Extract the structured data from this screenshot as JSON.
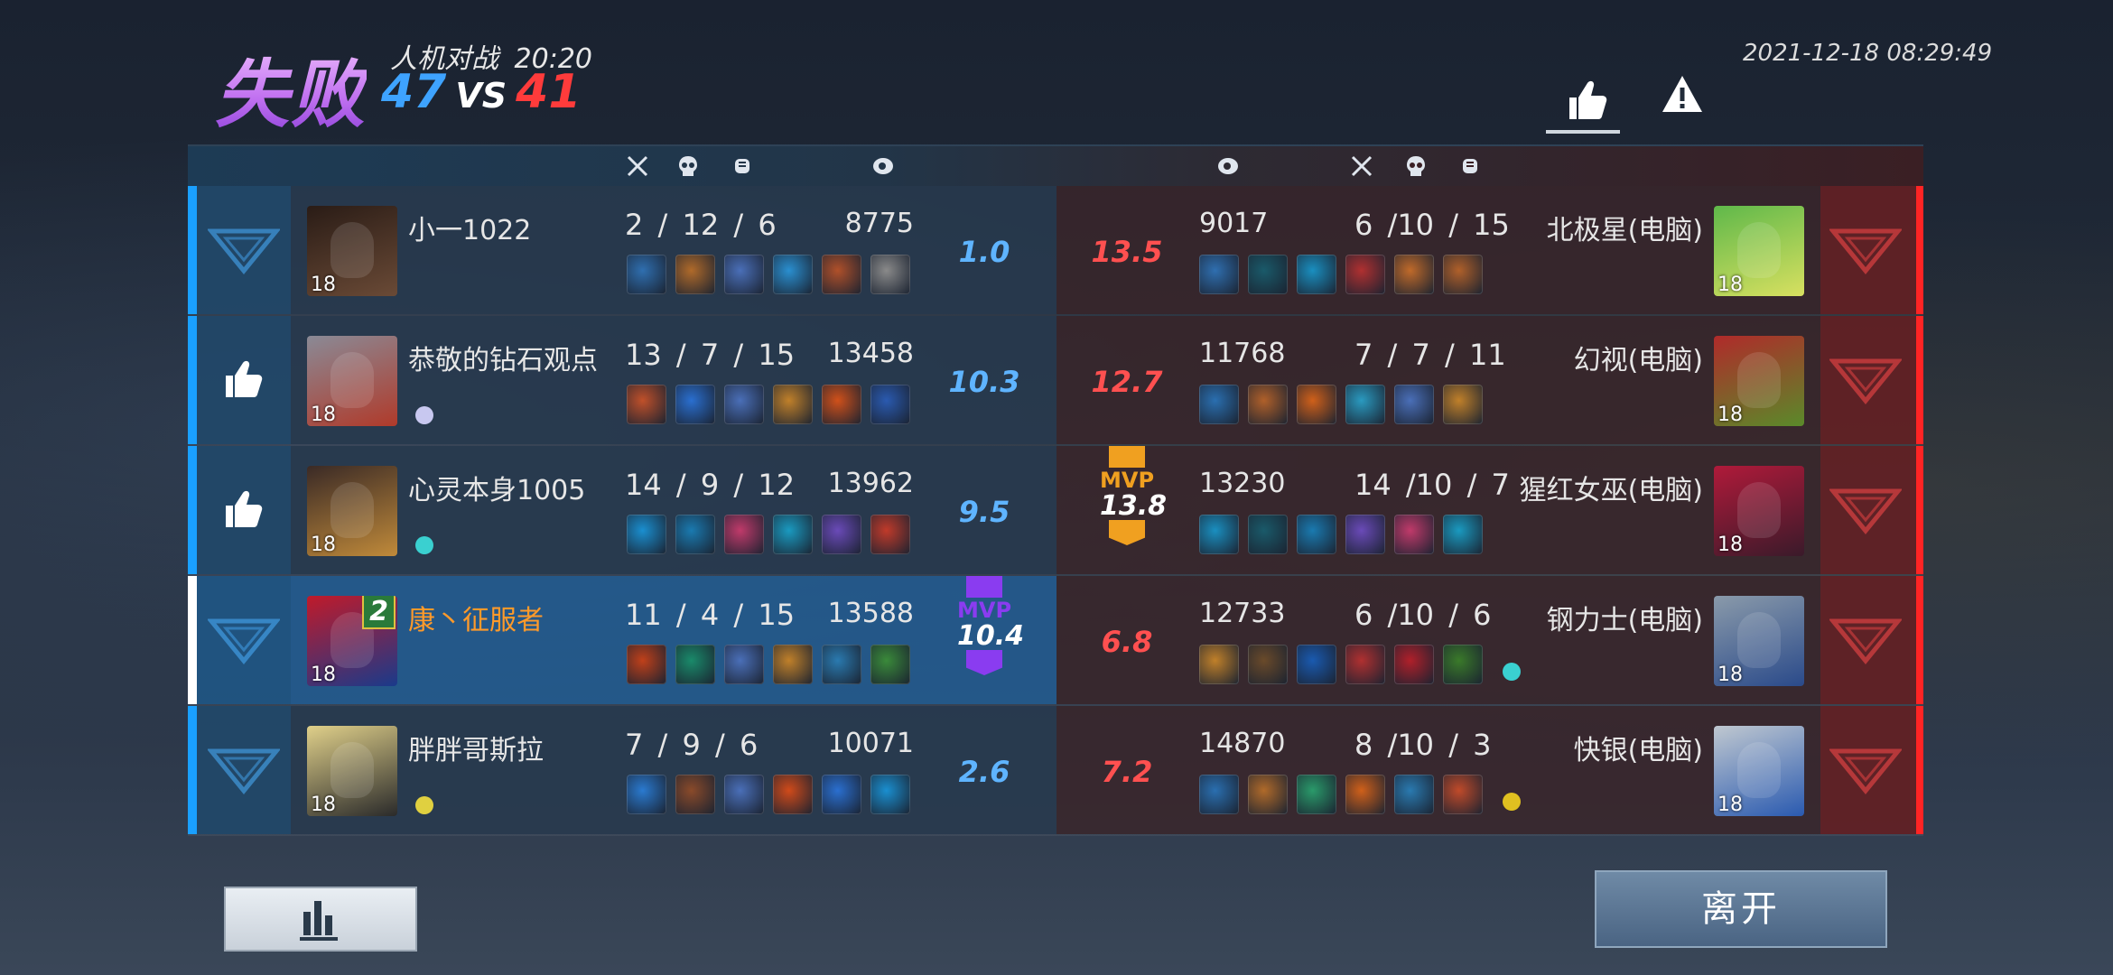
{
  "header": {
    "result": "失败",
    "mode": "人机对战",
    "duration": "20:20",
    "score_blue": "47",
    "score_vs": "VS",
    "score_red": "41",
    "datetime": "2021-12-18 08:29:49"
  },
  "columns": {
    "kills_icon": "crossed-swords-icon",
    "deaths_icon": "skull-icon",
    "assists_icon": "fist-icon",
    "damage_icon": "eye-icon"
  },
  "rows": [
    {
      "blue": {
        "name": "小一1022",
        "level": "18",
        "kda": "2 / 12 / 6",
        "damage": "8775",
        "score": "1.0",
        "action": "dislike",
        "self": false,
        "avatar_colors": [
          "#2a1c16",
          "#6a4a36"
        ],
        "items": [
          "#2f6fb0",
          "#b06a2a",
          "#4a6fb8",
          "#2a8fd0",
          "#b0502a",
          "#8a8a8a"
        ],
        "badge": ""
      },
      "red": {
        "name": "北极星(电脑)",
        "level": "18",
        "kda": "6 /10 / 15",
        "damage": "9017",
        "score": "13.5",
        "avatar_colors": [
          "#5fb84a",
          "#d8e060"
        ],
        "items": [
          "#2f6fb0",
          "#1a5a6a",
          "#1a8fc0",
          "#b03030",
          "#c06a2a",
          "#b0602a"
        ],
        "badge": ""
      }
    },
    {
      "blue": {
        "name": "恭敬的钻石观点",
        "level": "18",
        "kda": "13 / 7 / 15",
        "damage": "13458",
        "score": "10.3",
        "action": "like",
        "self": false,
        "avatar_colors": [
          "#8a8a96",
          "#b03a2a"
        ],
        "items": [
          "#c0502a",
          "#2a6fd0",
          "#4a6fb8",
          "#c0802a",
          "#d0501a",
          "#2a5ab0"
        ],
        "badge": "#c8c8f0"
      },
      "red": {
        "name": "幻视(电脑)",
        "level": "18",
        "kda": "7 / 7 / 11",
        "damage": "11768",
        "score": "12.7",
        "avatar_colors": [
          "#b02a2a",
          "#5a8a2a"
        ],
        "items": [
          "#2a6fb0",
          "#b0602a",
          "#d0601a",
          "#2a9ac0",
          "#4a6fb8",
          "#c0802a"
        ],
        "badge": ""
      }
    },
    {
      "blue": {
        "name": "心灵本身1005",
        "level": "18",
        "kda": "14 / 9 / 12",
        "damage": "13962",
        "score": "9.5",
        "action": "like",
        "self": false,
        "avatar_colors": [
          "#3a2a26",
          "#c08a3a"
        ],
        "items": [
          "#1a8fd0",
          "#1a7ab0",
          "#c03a6a",
          "#1a9ac0",
          "#6a4ab8",
          "#c03a2a"
        ],
        "badge": "#3ad0d0"
      },
      "red": {
        "name": "猩红女巫(电脑)",
        "level": "18",
        "kda": "14 /10 / 7",
        "damage": "13230",
        "score": "13.8",
        "mvp": "MVP",
        "avatar_colors": [
          "#b01a3a",
          "#3a1a2a"
        ],
        "items": [
          "#1a8fc0",
          "#1a5a6a",
          "#1a7ab0",
          "#6a4ab8",
          "#c03a6a",
          "#1a9ac0"
        ],
        "badge": ""
      }
    },
    {
      "blue": {
        "name": "康丶征服者",
        "level": "18",
        "kda": "11 / 4 / 15",
        "damage": "13588",
        "score": "10.4",
        "mvp": "MVP",
        "action": "dislike",
        "self": true,
        "rank_badge": "2",
        "avatar_colors": [
          "#c01a2a",
          "#1a3a8a"
        ],
        "items": [
          "#c0401a",
          "#1a8a6a",
          "#4a6fb8",
          "#c0802a",
          "#2a7ab0",
          "#3a8a3a"
        ],
        "badge": ""
      },
      "red": {
        "name": "钢力士(电脑)",
        "level": "18",
        "kda": "6 /10 / 6",
        "damage": "12733",
        "score": "6.8",
        "avatar_colors": [
          "#8a9aaa",
          "#2a4a8a"
        ],
        "items": [
          "#c0802a",
          "#6a4a2a",
          "#1a5ab0",
          "#b03030",
          "#b0202a",
          "#3a7a2a"
        ],
        "badge": "#3ad0d0"
      }
    },
    {
      "blue": {
        "name": "胖胖哥斯拉",
        "level": "18",
        "kda": "7 / 9 / 6",
        "damage": "10071",
        "score": "2.6",
        "action": "dislike",
        "self": false,
        "avatar_colors": [
          "#e0d08a",
          "#2a2a2a"
        ],
        "items": [
          "#2a7ad0",
          "#8a4a2a",
          "#4a6fb8",
          "#d04a1a",
          "#2a6fd0",
          "#1a8fd0"
        ],
        "badge": "#e0d040"
      },
      "red": {
        "name": "快银(电脑)",
        "level": "18",
        "kda": "8 /10 / 3",
        "damage": "14870",
        "score": "7.2",
        "avatar_colors": [
          "#c0c8d0",
          "#2a5ab0"
        ],
        "items": [
          "#2a6fb0",
          "#b06a2a",
          "#2a9a6a",
          "#d0601a",
          "#2a7ab0",
          "#c04a2a"
        ],
        "badge": "#e0c020"
      }
    }
  ],
  "buttons": {
    "stats_icon": "bar-chart-icon",
    "leave": "离开",
    "like_icon": "thumbs-up-icon",
    "report_icon": "warning-icon"
  },
  "colors": {
    "blue_team": "#1aa0ff",
    "red_team": "#ff2424",
    "mvp_blue": "#8a3cf0",
    "mvp_red": "#f0a020",
    "self_name": "#ff9a2a"
  }
}
